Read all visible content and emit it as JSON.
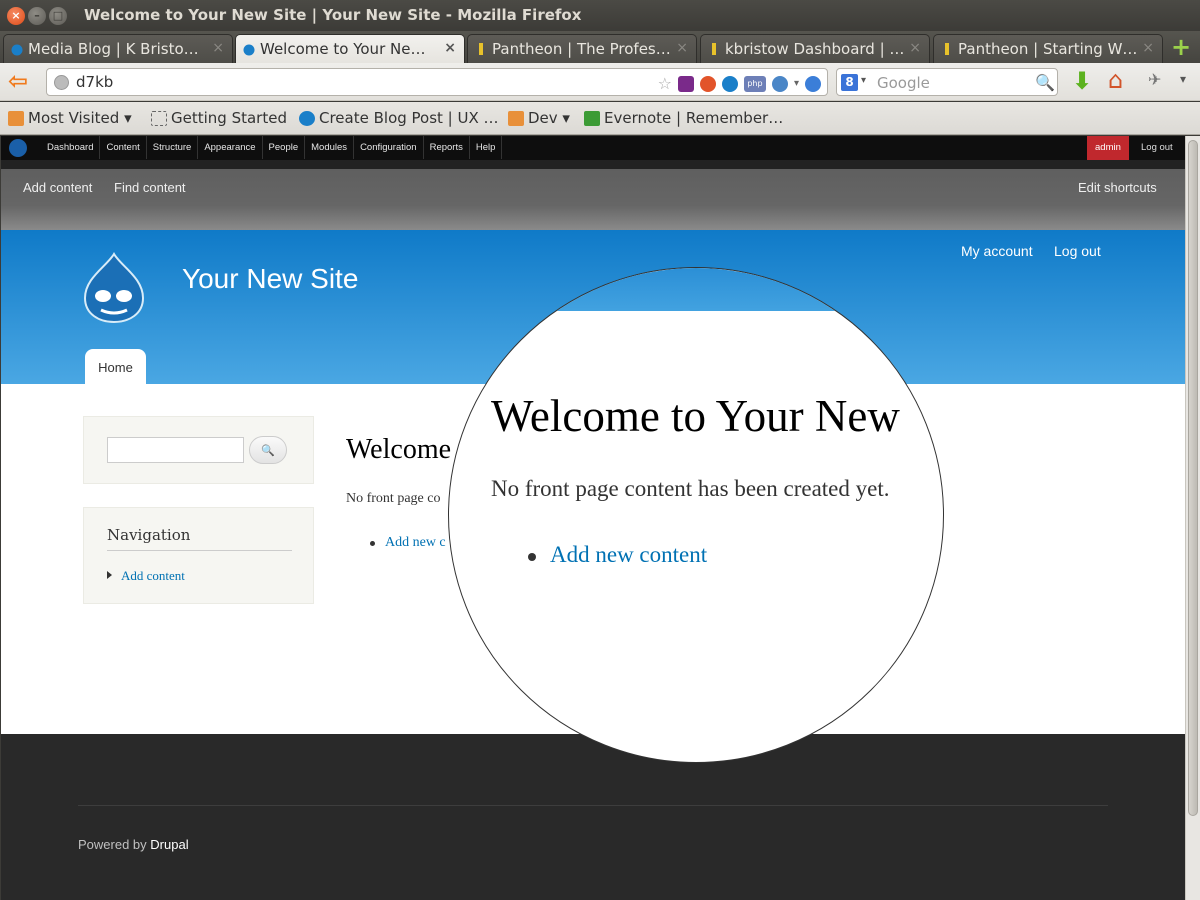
{
  "window": {
    "title": "Welcome to Your New Site | Your New Site - Mozilla Firefox",
    "buttons": {
      "close": "×",
      "minimize": "–",
      "maximize": "□"
    }
  },
  "tabs": [
    {
      "label": "Media Blog | K Bristo…",
      "active": false
    },
    {
      "label": "Welcome to Your Ne…",
      "active": true
    },
    {
      "label": "Pantheon | The Profes…",
      "active": false
    },
    {
      "label": "kbristow Dashboard | …",
      "active": false
    },
    {
      "label": "Pantheon | Starting W…",
      "active": false
    }
  ],
  "tab_close_glyph": "×",
  "new_tab_glyph": "+",
  "navbar": {
    "url": "d7kb",
    "search_placeholder": "Google",
    "search_engine_badge": "8"
  },
  "bookmarks": [
    {
      "label": "Most Visited ▾",
      "icon": "folder-icon"
    },
    {
      "label": "Getting Started",
      "icon": "page-icon"
    },
    {
      "label": "Create Blog Post | UX …",
      "icon": "drupal-icon"
    },
    {
      "label": "Dev ▾",
      "icon": "folder-icon"
    },
    {
      "label": "Evernote | Remember…",
      "icon": "evernote-icon"
    }
  ],
  "drupal_toolbar": {
    "menu": [
      "Dashboard",
      "Content",
      "Structure",
      "Appearance",
      "People",
      "Modules",
      "Configuration",
      "Reports",
      "Help"
    ],
    "user": "admin",
    "logout": "Log out",
    "shortcuts": [
      "Add content",
      "Find content"
    ],
    "edit_shortcuts": "Edit shortcuts"
  },
  "site": {
    "name": "Your New Site",
    "my_account": "My account",
    "log_out": "Log out",
    "home_tab": "Home"
  },
  "sidebar": {
    "search_button_glyph": "🔍",
    "navigation_title": "Navigation",
    "navigation_items": [
      "Add content"
    ]
  },
  "content": {
    "title_partial": "Welcome",
    "text_partial": "No front page co",
    "link_partial": "Add new c"
  },
  "magnifier": {
    "title": "Welcome to Your New",
    "text": "No front page content has been created yet.",
    "link": "Add new content"
  },
  "footer": {
    "powered_by": "Powered by",
    "drupal": "Drupal"
  },
  "colors": {
    "header_blue": "#0f7ac8",
    "link_blue": "#0071b3",
    "admin_red": "#c0282d",
    "footer_bg": "#292929"
  }
}
